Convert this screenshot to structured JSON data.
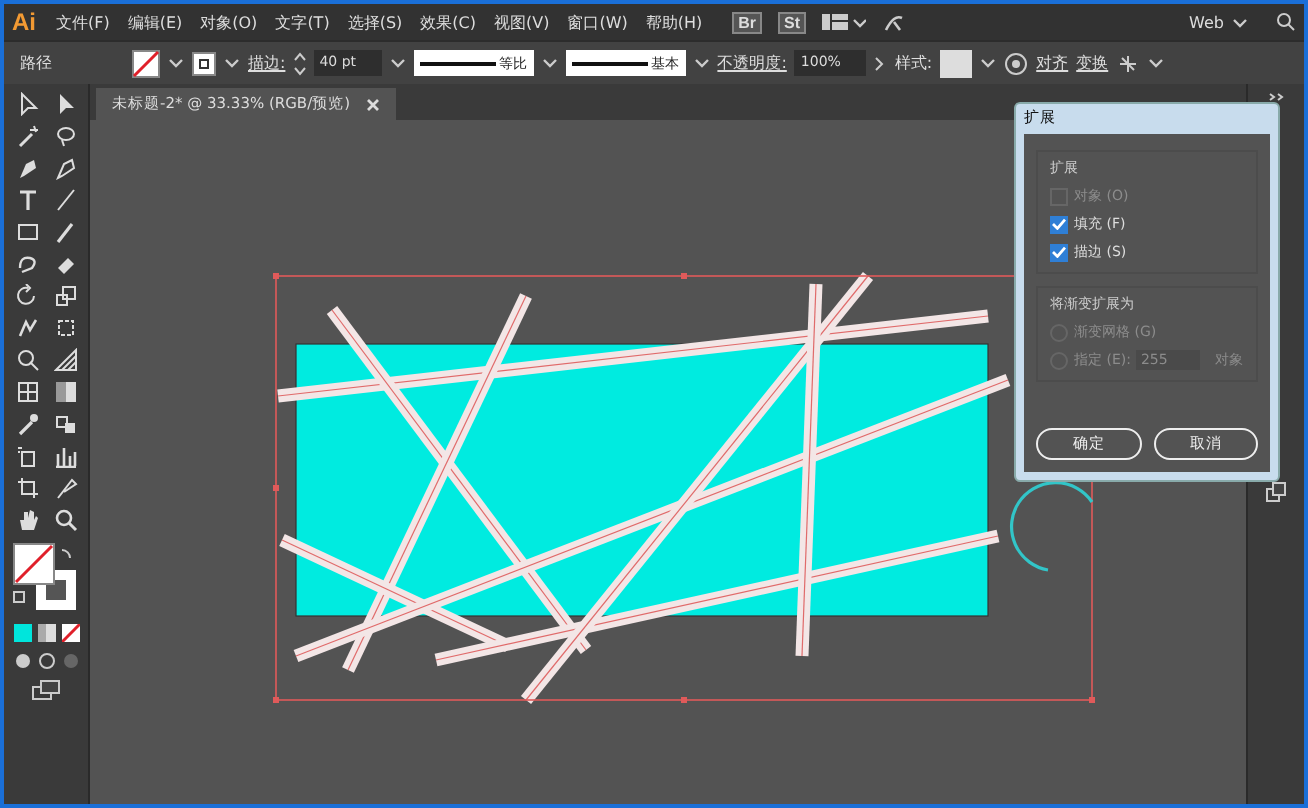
{
  "menu_bar": {
    "logo": "Ai",
    "items": [
      "文件(F)",
      "编辑(E)",
      "对象(O)",
      "文字(T)",
      "选择(S)",
      "效果(C)",
      "视图(V)",
      "窗口(W)",
      "帮助(H)"
    ],
    "app_buttons": [
      "Br",
      "St"
    ],
    "workspace": "Web"
  },
  "control_bar": {
    "selection_type": "路径",
    "stroke_label": "描边:",
    "stroke_weight": "40 pt",
    "profile": "等比",
    "brush": "基本",
    "opacity_label": "不透明度:",
    "opacity": "100%",
    "style_label": "样式:",
    "align": "对齐",
    "transform": "变换"
  },
  "document_tab": {
    "title": "未标题-2* @ 33.33% (RGB/预览)"
  },
  "dialog": {
    "title": "扩展",
    "expand_group": {
      "title": "扩展",
      "options": [
        {
          "label": "对象 (O)",
          "checked": false,
          "disabled": true
        },
        {
          "label": "填充 (F)",
          "checked": true,
          "disabled": false
        },
        {
          "label": "描边 (S)",
          "checked": true,
          "disabled": false
        }
      ]
    },
    "gradient_group": {
      "title": "将渐变扩展为",
      "options": [
        {
          "label": "渐变网格 (G)",
          "selected": false,
          "disabled": true
        },
        {
          "label": "指定 (E):",
          "selected": false,
          "disabled": true,
          "value": "255",
          "unit": "对象"
        }
      ]
    },
    "buttons": [
      "确定",
      "取消"
    ]
  }
}
